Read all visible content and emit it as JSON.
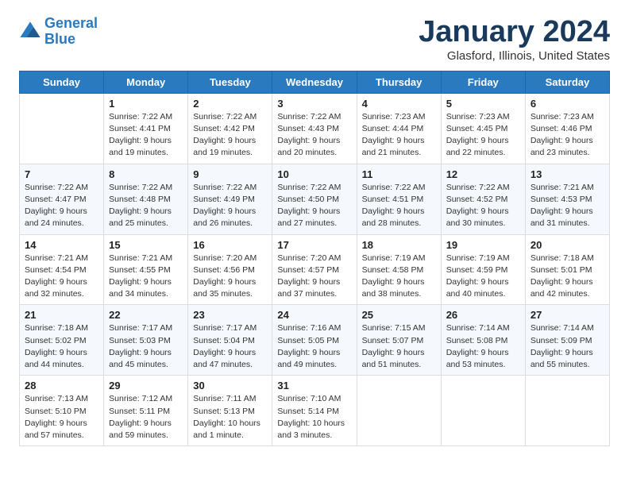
{
  "header": {
    "logo_line1": "General",
    "logo_line2": "Blue",
    "month_title": "January 2024",
    "location": "Glasford, Illinois, United States"
  },
  "weekdays": [
    "Sunday",
    "Monday",
    "Tuesday",
    "Wednesday",
    "Thursday",
    "Friday",
    "Saturday"
  ],
  "weeks": [
    [
      {
        "day": "",
        "info": ""
      },
      {
        "day": "1",
        "info": "Sunrise: 7:22 AM\nSunset: 4:41 PM\nDaylight: 9 hours\nand 19 minutes."
      },
      {
        "day": "2",
        "info": "Sunrise: 7:22 AM\nSunset: 4:42 PM\nDaylight: 9 hours\nand 19 minutes."
      },
      {
        "day": "3",
        "info": "Sunrise: 7:22 AM\nSunset: 4:43 PM\nDaylight: 9 hours\nand 20 minutes."
      },
      {
        "day": "4",
        "info": "Sunrise: 7:23 AM\nSunset: 4:44 PM\nDaylight: 9 hours\nand 21 minutes."
      },
      {
        "day": "5",
        "info": "Sunrise: 7:23 AM\nSunset: 4:45 PM\nDaylight: 9 hours\nand 22 minutes."
      },
      {
        "day": "6",
        "info": "Sunrise: 7:23 AM\nSunset: 4:46 PM\nDaylight: 9 hours\nand 23 minutes."
      }
    ],
    [
      {
        "day": "7",
        "info": "Sunrise: 7:22 AM\nSunset: 4:47 PM\nDaylight: 9 hours\nand 24 minutes."
      },
      {
        "day": "8",
        "info": "Sunrise: 7:22 AM\nSunset: 4:48 PM\nDaylight: 9 hours\nand 25 minutes."
      },
      {
        "day": "9",
        "info": "Sunrise: 7:22 AM\nSunset: 4:49 PM\nDaylight: 9 hours\nand 26 minutes."
      },
      {
        "day": "10",
        "info": "Sunrise: 7:22 AM\nSunset: 4:50 PM\nDaylight: 9 hours\nand 27 minutes."
      },
      {
        "day": "11",
        "info": "Sunrise: 7:22 AM\nSunset: 4:51 PM\nDaylight: 9 hours\nand 28 minutes."
      },
      {
        "day": "12",
        "info": "Sunrise: 7:22 AM\nSunset: 4:52 PM\nDaylight: 9 hours\nand 30 minutes."
      },
      {
        "day": "13",
        "info": "Sunrise: 7:21 AM\nSunset: 4:53 PM\nDaylight: 9 hours\nand 31 minutes."
      }
    ],
    [
      {
        "day": "14",
        "info": "Sunrise: 7:21 AM\nSunset: 4:54 PM\nDaylight: 9 hours\nand 32 minutes."
      },
      {
        "day": "15",
        "info": "Sunrise: 7:21 AM\nSunset: 4:55 PM\nDaylight: 9 hours\nand 34 minutes."
      },
      {
        "day": "16",
        "info": "Sunrise: 7:20 AM\nSunset: 4:56 PM\nDaylight: 9 hours\nand 35 minutes."
      },
      {
        "day": "17",
        "info": "Sunrise: 7:20 AM\nSunset: 4:57 PM\nDaylight: 9 hours\nand 37 minutes."
      },
      {
        "day": "18",
        "info": "Sunrise: 7:19 AM\nSunset: 4:58 PM\nDaylight: 9 hours\nand 38 minutes."
      },
      {
        "day": "19",
        "info": "Sunrise: 7:19 AM\nSunset: 4:59 PM\nDaylight: 9 hours\nand 40 minutes."
      },
      {
        "day": "20",
        "info": "Sunrise: 7:18 AM\nSunset: 5:01 PM\nDaylight: 9 hours\nand 42 minutes."
      }
    ],
    [
      {
        "day": "21",
        "info": "Sunrise: 7:18 AM\nSunset: 5:02 PM\nDaylight: 9 hours\nand 44 minutes."
      },
      {
        "day": "22",
        "info": "Sunrise: 7:17 AM\nSunset: 5:03 PM\nDaylight: 9 hours\nand 45 minutes."
      },
      {
        "day": "23",
        "info": "Sunrise: 7:17 AM\nSunset: 5:04 PM\nDaylight: 9 hours\nand 47 minutes."
      },
      {
        "day": "24",
        "info": "Sunrise: 7:16 AM\nSunset: 5:05 PM\nDaylight: 9 hours\nand 49 minutes."
      },
      {
        "day": "25",
        "info": "Sunrise: 7:15 AM\nSunset: 5:07 PM\nDaylight: 9 hours\nand 51 minutes."
      },
      {
        "day": "26",
        "info": "Sunrise: 7:14 AM\nSunset: 5:08 PM\nDaylight: 9 hours\nand 53 minutes."
      },
      {
        "day": "27",
        "info": "Sunrise: 7:14 AM\nSunset: 5:09 PM\nDaylight: 9 hours\nand 55 minutes."
      }
    ],
    [
      {
        "day": "28",
        "info": "Sunrise: 7:13 AM\nSunset: 5:10 PM\nDaylight: 9 hours\nand 57 minutes."
      },
      {
        "day": "29",
        "info": "Sunrise: 7:12 AM\nSunset: 5:11 PM\nDaylight: 9 hours\nand 59 minutes."
      },
      {
        "day": "30",
        "info": "Sunrise: 7:11 AM\nSunset: 5:13 PM\nDaylight: 10 hours\nand 1 minute."
      },
      {
        "day": "31",
        "info": "Sunrise: 7:10 AM\nSunset: 5:14 PM\nDaylight: 10 hours\nand 3 minutes."
      },
      {
        "day": "",
        "info": ""
      },
      {
        "day": "",
        "info": ""
      },
      {
        "day": "",
        "info": ""
      }
    ]
  ]
}
